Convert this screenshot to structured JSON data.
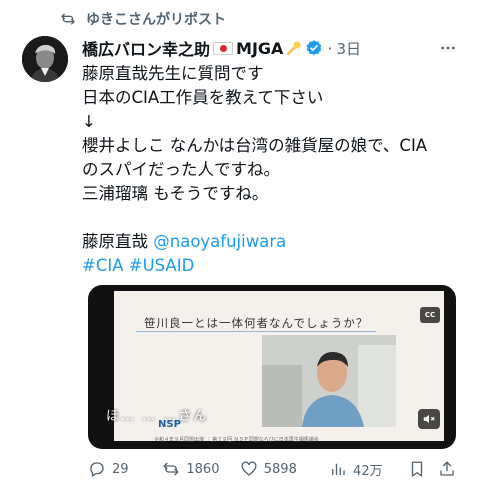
{
  "repost": {
    "label": "ゆきこさんがリポスト"
  },
  "author": {
    "display_name": "橋広バロン幸之助",
    "suffix": "MJGA",
    "time": "3日"
  },
  "tweet": {
    "lines": [
      "藤原直哉先生に質問です",
      "日本のCIA工作員を教えて下さい",
      "↓",
      "櫻井よしこ なんかは台湾の雑貨屋の娘で、CIA",
      "のスパイだった人ですね。",
      "三浦瑠璃 もそうですね。"
    ],
    "mention_prefix": "藤原直哉 ",
    "mention": "@naoyafujiwara",
    "hashtags": "#CIA #USAID"
  },
  "media": {
    "slide_title": "笹川良一とは一体何者なんでしょうか？",
    "subtitle": "ほ… … …さん",
    "logo": "NSP",
    "caption": "令和４年９月同盟出演 ｜ 第７９回 ＮＳＰ同盟ならびに日本再生相馬議会",
    "cc": "CC"
  },
  "actions": {
    "replies": "29",
    "reposts": "1860",
    "likes": "5898",
    "views": "42万"
  }
}
